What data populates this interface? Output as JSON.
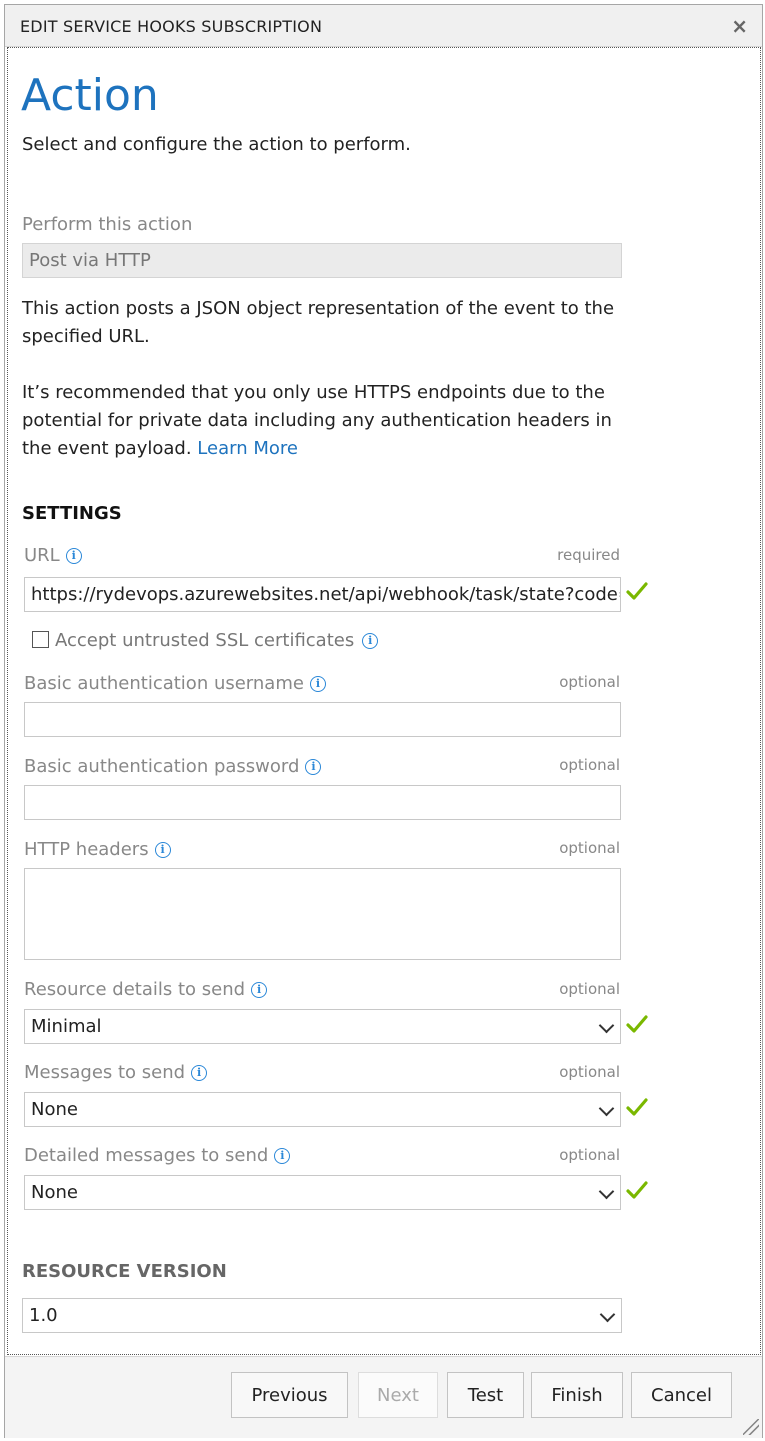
{
  "dialog": {
    "title": "EDIT SERVICE HOOKS SUBSCRIPTION",
    "close_glyph": "×"
  },
  "page": {
    "heading": "Action",
    "subtitle": "Select and configure the action to perform."
  },
  "action": {
    "label": "Perform this action",
    "value": "Post via HTTP",
    "description": "This action posts a JSON object representation of the event to the specified URL.",
    "recommendation": "It’s recommended that you only use HTTPS endpoints due to the potential for private data including any authentication headers in the event payload.",
    "learn_more": "Learn More"
  },
  "settings": {
    "heading": "SETTINGS",
    "url": {
      "label": "URL",
      "requirement": "required",
      "value": "https://rydevops.azurewebsites.net/api/webhook/task/state?code=",
      "valid": true
    },
    "accept_untrusted_ssl": {
      "label": "Accept untrusted SSL certificates",
      "checked": false
    },
    "basic_auth_username": {
      "label": "Basic authentication username",
      "requirement": "optional",
      "value": ""
    },
    "basic_auth_password": {
      "label": "Basic authentication password",
      "requirement": "optional",
      "value": ""
    },
    "http_headers": {
      "label": "HTTP headers",
      "requirement": "optional",
      "value": ""
    },
    "resource_details": {
      "label": "Resource details to send",
      "requirement": "optional",
      "selected": "Minimal",
      "valid": true
    },
    "messages": {
      "label": "Messages to send",
      "requirement": "optional",
      "selected": "None",
      "valid": true
    },
    "detailed_messages": {
      "label": "Detailed messages to send",
      "requirement": "optional",
      "selected": "None",
      "valid": true
    }
  },
  "resource_version": {
    "heading": "RESOURCE VERSION",
    "selected": "1.0"
  },
  "footer": {
    "previous": "Previous",
    "next": "Next",
    "test": "Test",
    "finish": "Finish",
    "cancel": "Cancel"
  },
  "colors": {
    "accent": "#1e73be",
    "valid_check": "#7ab800"
  }
}
